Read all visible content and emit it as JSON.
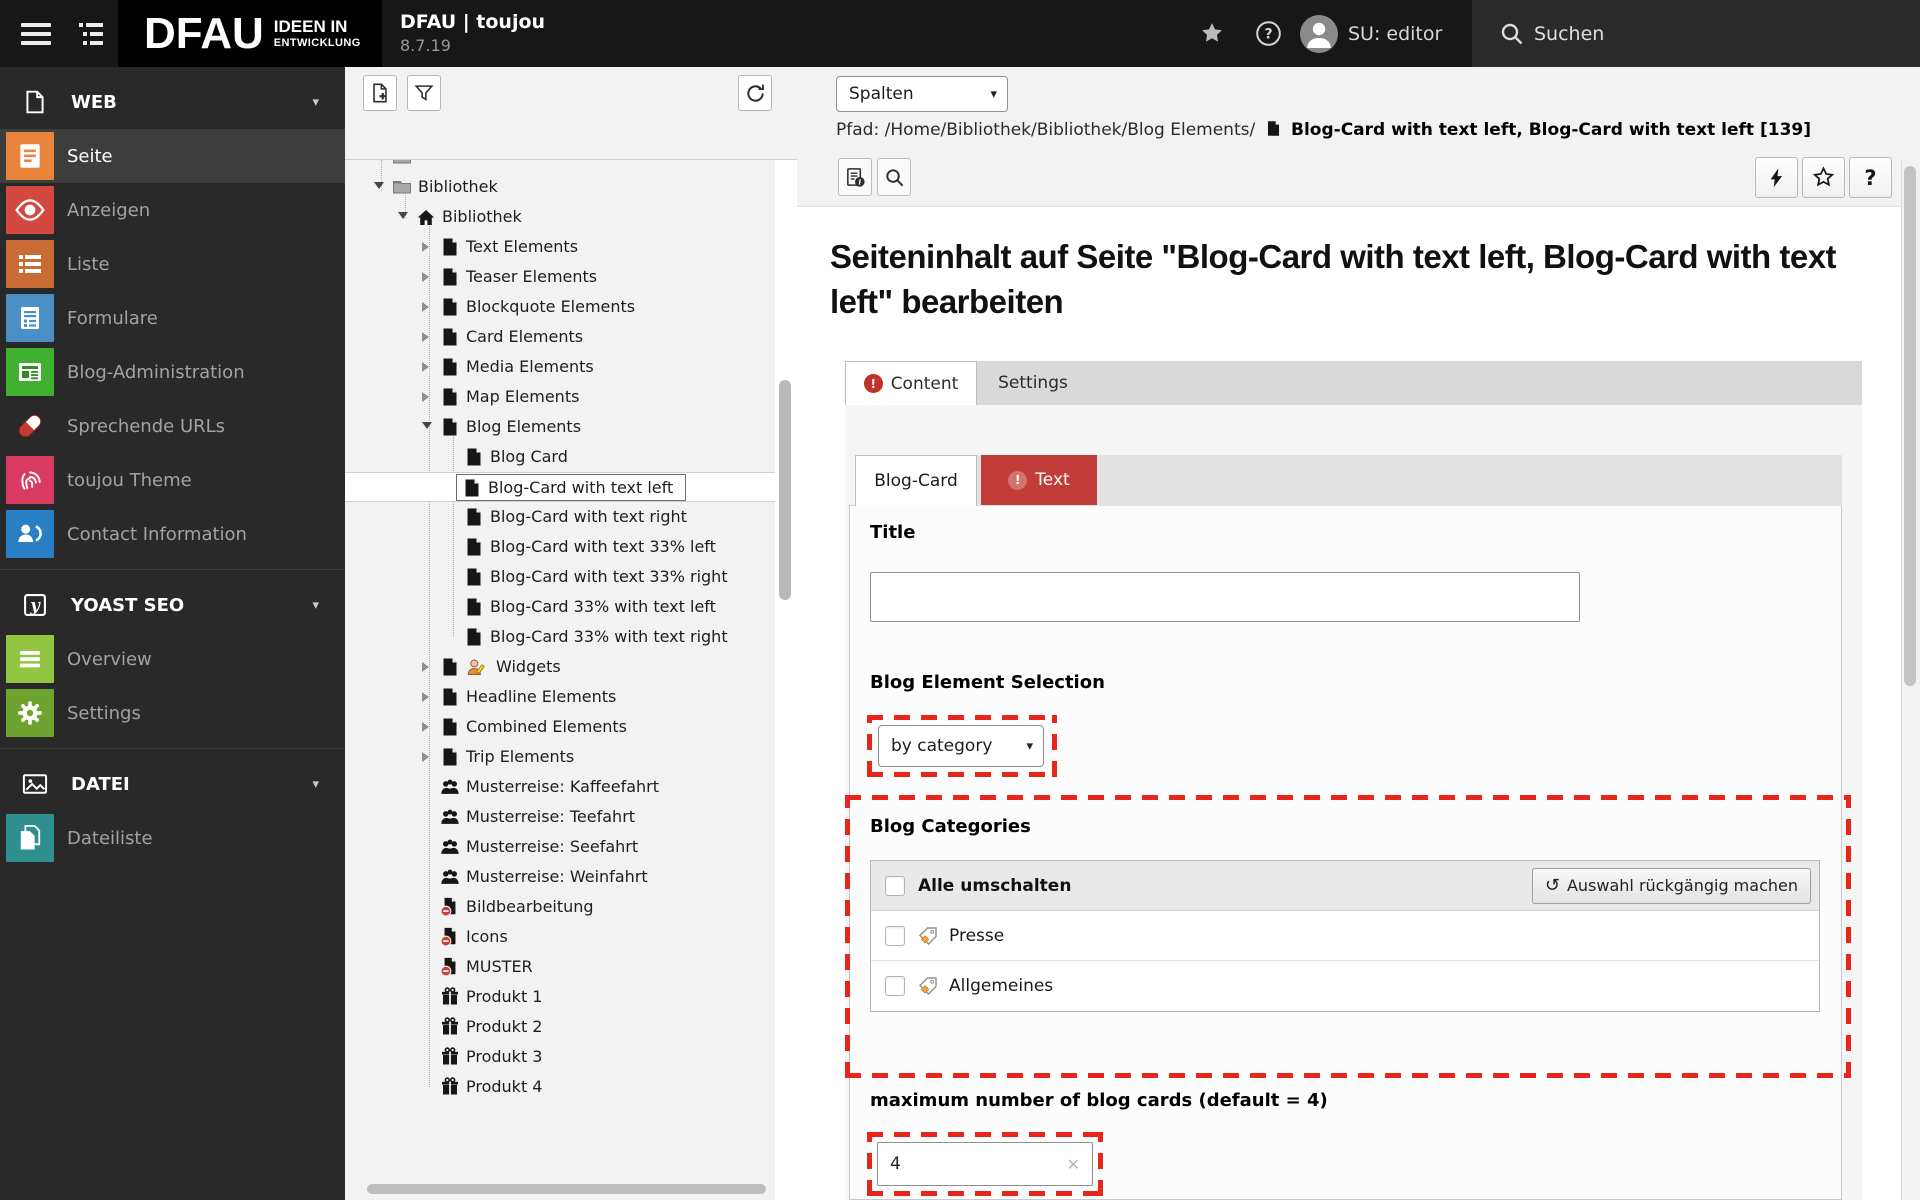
{
  "topbar": {
    "logo_main": "DFAU",
    "logo_sub1": "IDEEN IN",
    "logo_sub2": "ENTWICKLUNG",
    "site_title": "DFAU | toujou",
    "site_version": "8.7.19",
    "user_label": "SU: editor",
    "search_label": "Suchen"
  },
  "sidebar": {
    "sections": [
      {
        "label": "WEB",
        "icon": "doc-outline",
        "items": [
          {
            "label": "Seite",
            "icon": "page-lines",
            "color": "#e8843c",
            "active": true
          },
          {
            "label": "Anzeigen",
            "icon": "eye",
            "color": "#d4493f",
            "active": false
          },
          {
            "label": "Liste",
            "icon": "list",
            "color": "#c96b34",
            "active": false
          },
          {
            "label": "Formulare",
            "icon": "form",
            "color": "#4a8fc5",
            "active": false
          },
          {
            "label": "Blog-Administration",
            "icon": "news",
            "color": "#3fb02f",
            "active": false
          },
          {
            "label": "Sprechende URLs",
            "icon": "pill",
            "color": "transparent",
            "active": false
          },
          {
            "label": "toujou Theme",
            "icon": "fingerprint",
            "color": "#d83a62",
            "active": false
          },
          {
            "label": "Contact Information",
            "icon": "contact",
            "color": "#2a7fc4",
            "active": false
          }
        ]
      },
      {
        "label": "YOAST SEO",
        "icon": "yoast",
        "items": [
          {
            "label": "Overview",
            "icon": "lines3",
            "color": "#93c542",
            "active": false
          },
          {
            "label": "Settings",
            "icon": "gear",
            "color": "#6da32e",
            "active": false
          }
        ]
      },
      {
        "label": "DATEI",
        "icon": "image-outline",
        "items": [
          {
            "label": "Dateiliste",
            "icon": "filelist",
            "color": "#2f8e8e",
            "active": false
          }
        ]
      }
    ]
  },
  "tree": {
    "items": [
      {
        "level": 1,
        "icon": "folder",
        "arrow": null,
        "label": ""
      },
      {
        "level": 1,
        "icon": "folder",
        "arrow": "down",
        "label": "Bibliothek"
      },
      {
        "level": 2,
        "icon": "home",
        "arrow": "down",
        "label": "Bibliothek"
      },
      {
        "level": 3,
        "icon": "page",
        "arrow": "right",
        "label": "Text Elements"
      },
      {
        "level": 3,
        "icon": "page",
        "arrow": "right",
        "label": "Teaser Elements"
      },
      {
        "level": 3,
        "icon": "page",
        "arrow": "right",
        "label": "Blockquote Elements"
      },
      {
        "level": 3,
        "icon": "page",
        "arrow": "right",
        "label": "Card Elements"
      },
      {
        "level": 3,
        "icon": "page",
        "arrow": "right",
        "label": "Media Elements"
      },
      {
        "level": 3,
        "icon": "page",
        "arrow": "right",
        "label": "Map Elements"
      },
      {
        "level": 3,
        "icon": "page",
        "arrow": "down",
        "label": "Blog Elements"
      },
      {
        "level": 4,
        "icon": "page",
        "arrow": null,
        "label": "Blog Card"
      },
      {
        "level": 4,
        "icon": "page",
        "arrow": null,
        "label": "Blog-Card with text left",
        "selected": true
      },
      {
        "level": 4,
        "icon": "page",
        "arrow": null,
        "label": "Blog-Card with text right"
      },
      {
        "level": 4,
        "icon": "page",
        "arrow": null,
        "label": "Blog-Card with text 33% left"
      },
      {
        "level": 4,
        "icon": "page",
        "arrow": null,
        "label": "Blog-Card with text 33% right"
      },
      {
        "level": 4,
        "icon": "page",
        "arrow": null,
        "label": "Blog-Card 33% with text left"
      },
      {
        "level": 4,
        "icon": "page",
        "arrow": null,
        "label": "Blog-Card 33% with text right"
      },
      {
        "level": 3,
        "icon": "page",
        "arrow": "right",
        "label": "Widgets",
        "extra": "user-edit"
      },
      {
        "level": 3,
        "icon": "page",
        "arrow": "right",
        "label": "Headline Elements"
      },
      {
        "level": 3,
        "icon": "page",
        "arrow": "right",
        "label": "Combined Elements"
      },
      {
        "level": 3,
        "icon": "page",
        "arrow": "right",
        "label": "Trip Elements"
      },
      {
        "level": 3,
        "icon": "people",
        "arrow": null,
        "label": "Musterreise: Kaffeefahrt"
      },
      {
        "level": 3,
        "icon": "people",
        "arrow": null,
        "label": "Musterreise: Teefahrt"
      },
      {
        "level": 3,
        "icon": "people",
        "arrow": null,
        "label": "Musterreise: Seefahrt"
      },
      {
        "level": 3,
        "icon": "people",
        "arrow": null,
        "label": "Musterreise: Weinfahrt"
      },
      {
        "level": 3,
        "icon": "page-hidden",
        "arrow": null,
        "label": "Bildbearbeitung"
      },
      {
        "level": 3,
        "icon": "page-hidden",
        "arrow": null,
        "label": "Icons"
      },
      {
        "level": 3,
        "icon": "page-hidden",
        "arrow": null,
        "label": "MUSTER"
      },
      {
        "level": 3,
        "icon": "gift",
        "arrow": null,
        "label": "Produkt 1"
      },
      {
        "level": 3,
        "icon": "gift",
        "arrow": null,
        "label": "Produkt 2"
      },
      {
        "level": 3,
        "icon": "gift",
        "arrow": null,
        "label": "Produkt 3"
      },
      {
        "level": 3,
        "icon": "gift",
        "arrow": null,
        "label": "Produkt 4"
      }
    ]
  },
  "content": {
    "columns_select": "Spalten",
    "path_label": "Pfad:",
    "path_value": "/Home/Bibliothek/Bibliothek/Blog Elements/",
    "record_title": "Blog-Card with text left, Blog-Card with text left [139]",
    "heading": "Seiteninhalt auf Seite \"Blog-Card with text left, Blog-Card with text left\" bearbeiten",
    "tabs": [
      {
        "label": "Content",
        "active": true,
        "error": true
      },
      {
        "label": "Settings",
        "active": false,
        "error": false
      }
    ],
    "subtabs": [
      {
        "label": "Blog-Card",
        "active": true,
        "error": false
      },
      {
        "label": "Text",
        "active": false,
        "error": true
      }
    ],
    "form": {
      "title_label": "Title",
      "title_value": "",
      "selection_label": "Blog Element Selection",
      "selection_value": "by category",
      "categories_label": "Blog Categories",
      "toggle_all_label": "Alle umschalten",
      "undo_button_label": "Auswahl rückgängig machen",
      "categories": [
        {
          "label": "Presse"
        },
        {
          "label": "Allgemeines"
        }
      ],
      "max_label": "maximum number of blog cards (default = 4)",
      "max_value": "4"
    }
  },
  "colors": {
    "annotation_red": "#e8251a",
    "error_tab_red": "#c23d3a",
    "badge_red": "#bf3129",
    "topbar_black": "#171717",
    "sidebar_gray": "#292929"
  }
}
